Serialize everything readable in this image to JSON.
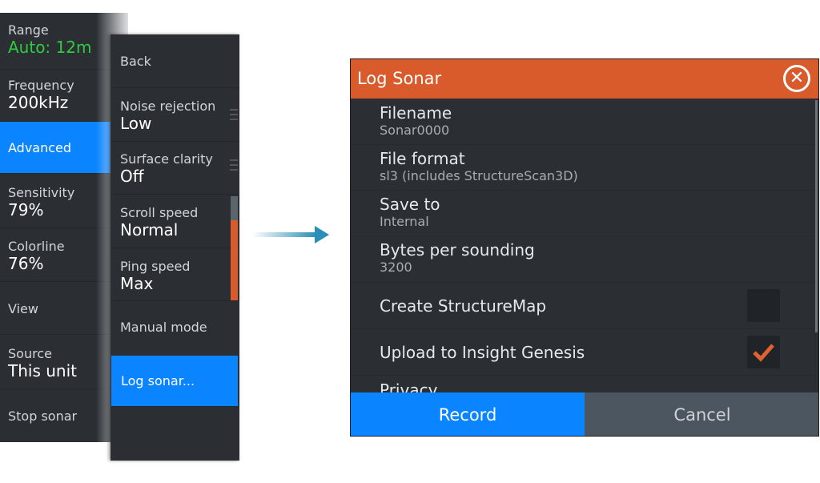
{
  "left_menu": {
    "items": [
      {
        "label": "Range",
        "value": "Auto: 12m"
      },
      {
        "label": "Frequency",
        "value": "200kHz"
      },
      {
        "label": "Advanced"
      },
      {
        "label": "Sensitivity",
        "value": "79%"
      },
      {
        "label": "Colorline",
        "value": "76%"
      },
      {
        "label": "View"
      },
      {
        "label": "Source",
        "value": "This unit"
      },
      {
        "label": "Stop sonar"
      }
    ],
    "value_accent": "#2ecc40",
    "selected_color": "#0a84ff"
  },
  "advanced_menu": {
    "items": [
      {
        "label": "Back"
      },
      {
        "label": "Noise rejection",
        "value": "Low"
      },
      {
        "label": "Surface clarity",
        "value": "Off"
      },
      {
        "label": "Scroll speed",
        "value": "Normal"
      },
      {
        "label": "Ping speed",
        "value": "Max"
      },
      {
        "label": "Manual mode"
      },
      {
        "label": "Log sonar..."
      }
    ]
  },
  "dialog": {
    "title": "Log Sonar",
    "header_color": "#d95b2b",
    "close_icon": "close-circle-icon",
    "fields": [
      {
        "label": "Filename",
        "value": "Sonar0000"
      },
      {
        "label": "File format",
        "value": "sl3 (includes StructureScan3D)"
      },
      {
        "label": "Save to",
        "value": "Internal"
      },
      {
        "label": "Bytes per sounding",
        "value": "3200"
      }
    ],
    "checkboxes": [
      {
        "label": "Create StructureMap",
        "checked": false
      },
      {
        "label": "Upload to Insight Genesis",
        "checked": true
      }
    ],
    "partial_item": "Privacy",
    "record_label": "Record",
    "cancel_label": "Cancel"
  }
}
